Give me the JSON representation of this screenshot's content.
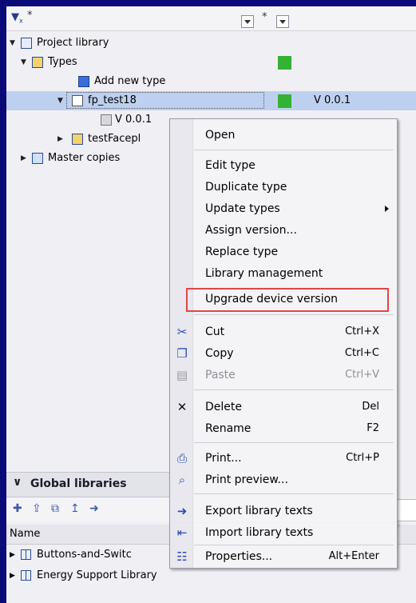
{
  "header": {
    "filter_icon": "filter-clear-icon",
    "col1_star": "*",
    "col2_star": "*"
  },
  "tree": {
    "project_library": "Project library",
    "types": "Types",
    "add_new_type": "Add new type",
    "fp_test18": "fp_test18",
    "fp_version_col": "V 0.0.1",
    "fp_child_version": "V 0.0.1",
    "test_faceplate": "testFacepl",
    "master_copies": "Master copies"
  },
  "global_libraries": {
    "title": "Global libraries",
    "column_name": "Name",
    "items": [
      "Buttons-and-Switc",
      "Energy Support Library"
    ]
  },
  "context_menu": {
    "open": "Open",
    "edit_type": "Edit type",
    "duplicate_type": "Duplicate type",
    "update_types": "Update types",
    "assign_version": "Assign version...",
    "replace_type": "Replace type",
    "library_management": "Library management",
    "upgrade_device_version": "Upgrade device version",
    "cut": "Cut",
    "cut_sc": "Ctrl+X",
    "copy": "Copy",
    "copy_sc": "Ctrl+C",
    "paste": "Paste",
    "paste_sc": "Ctrl+V",
    "delete": "Delete",
    "delete_sc": "Del",
    "rename": "Rename",
    "rename_sc": "F2",
    "print": "Print...",
    "print_sc": "Ctrl+P",
    "print_preview": "Print preview...",
    "export_texts": "Export library texts",
    "import_texts": "Import library texts",
    "properties": "Properties...",
    "properties_sc": "Alt+Enter"
  },
  "colors": {
    "status_green": "#34b233",
    "selection": "#bed0ef",
    "highlight_box": "#e24646"
  }
}
